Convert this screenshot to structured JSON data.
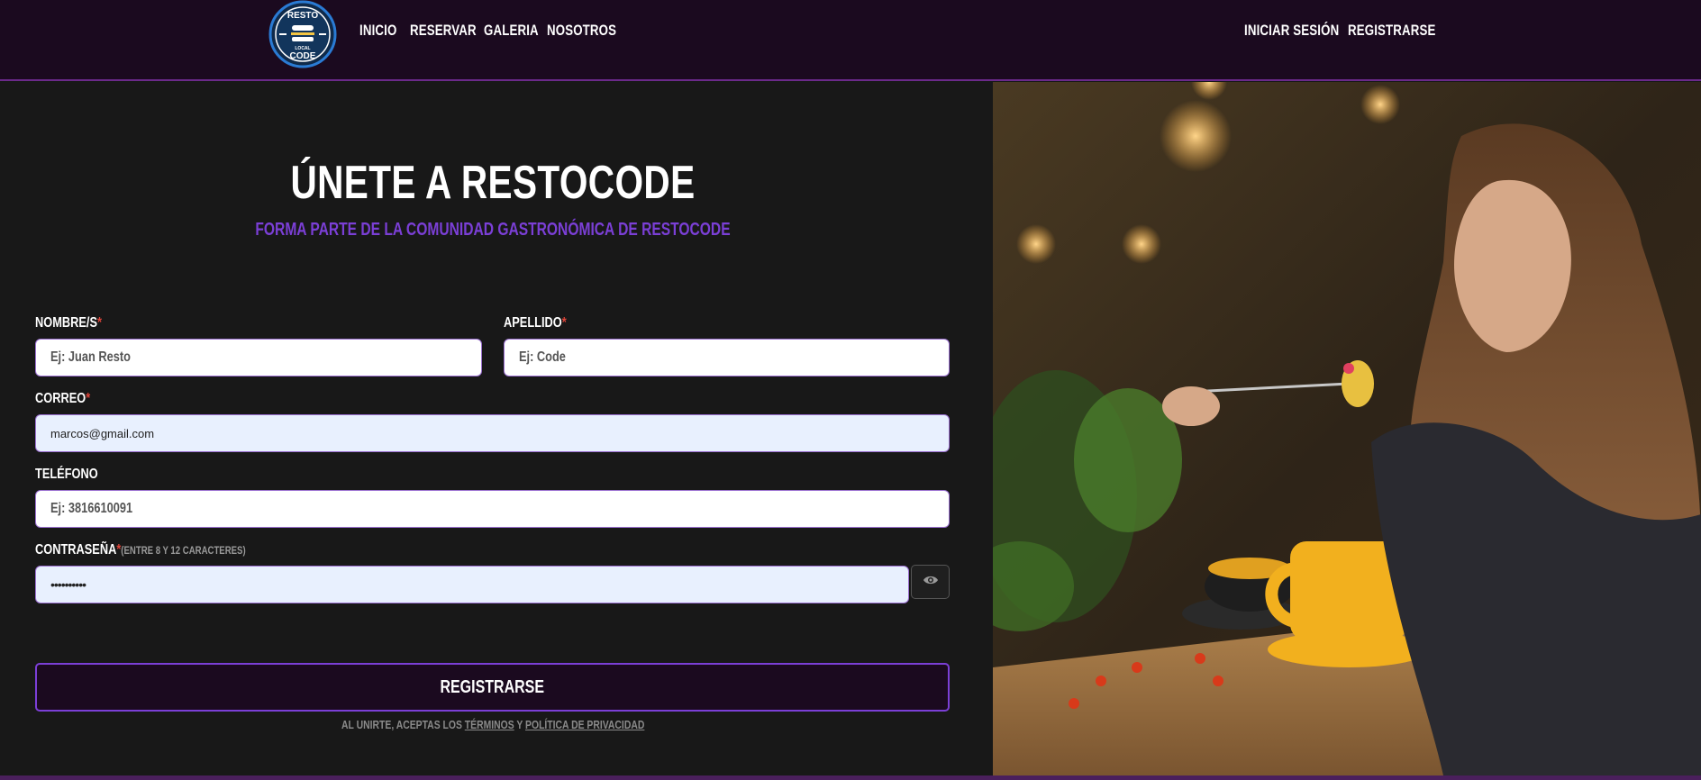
{
  "navbar": {
    "logo": {
      "top_text": "RESTO",
      "bottom_text": "CODE",
      "middle_text": "LOCAL"
    },
    "left_links": [
      "INICIO",
      "RESERVAR",
      "GALERIA",
      "NOSOTROS"
    ],
    "right_links": [
      "INICIAR SESIÓN",
      "REGISTRARSE"
    ]
  },
  "form": {
    "title": "ÚNETE A RESTOCODE",
    "subtitle": "FORMA PARTE DE LA COMUNIDAD GASTRONÓMICA DE RESTOCODE",
    "nombre": {
      "label": "NOMBRE/S",
      "required": "*",
      "placeholder": "Ej: Juan Resto",
      "value": ""
    },
    "apellido": {
      "label": "APELLIDO",
      "required": "*",
      "placeholder": "Ej: Code",
      "value": ""
    },
    "correo": {
      "label": "CORREO",
      "required": "*",
      "placeholder": "",
      "value": "marcos@gmail.com"
    },
    "telefono": {
      "label": "TELÉFONO",
      "placeholder": "Ej: 3816610091",
      "value": ""
    },
    "contrasena": {
      "label": "CONTRASEÑA",
      "required": "*",
      "hint": "(ENTRE 8 Y 12 CARACTERES)",
      "value": "••••••••••"
    },
    "toggle_password_icon": "eye-icon",
    "submit_label": "REGISTRARSE",
    "legal": {
      "prefix": "AL UNIRTE, ACEPTAS LOS ",
      "terms": "TÉRMINOS",
      "conj": " Y ",
      "privacy": "POLÍTICA DE PRIVACIDAD"
    }
  },
  "colors": {
    "navbar_bg": "#1b0a1f",
    "page_bg": "#181818",
    "accent": "#7b3fd6",
    "required": "#e0453a",
    "autofill_bg": "#e8f0fe"
  }
}
